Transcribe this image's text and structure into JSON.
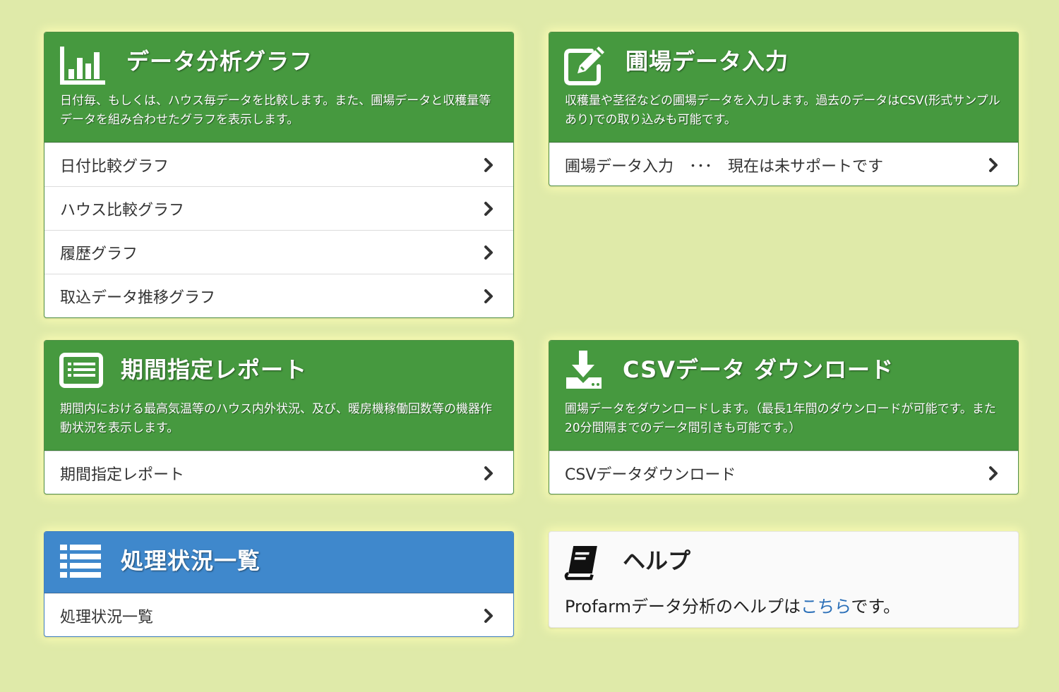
{
  "panels": {
    "graph": {
      "title": "データ分析グラフ",
      "description": "日付毎、もしくは、ハウス毎データを比較します。また、圃場データと収穫量等データを組み合わせたグラフを表示します。",
      "items": [
        "日付比較グラフ",
        "ハウス比較グラフ",
        "履歴グラフ",
        "取込データ推移グラフ"
      ]
    },
    "field_input": {
      "title": "圃場データ入力",
      "description": "収穫量や茎径などの圃場データを入力します。過去のデータはCSV(形式サンプルあり)での取り込みも可能です。",
      "items": [
        "圃場データ入力　･･･　現在は未サポートです"
      ]
    },
    "report": {
      "title": "期間指定レポート",
      "description": "期間内における最高気温等のハウス内外状況、及び、暖房機稼働回数等の機器作動状況を表示します。",
      "items": [
        "期間指定レポート"
      ]
    },
    "csv": {
      "title": "CSVデータ ダウンロード",
      "description": "圃場データをダウンロードします。（最長1年間のダウンロードが可能です。また20分間隔までのデータ間引きも可能です。）",
      "items": [
        "CSVデータダウンロード"
      ]
    },
    "status": {
      "title": "処理状況一覧",
      "items": [
        "処理状況一覧"
      ]
    },
    "help": {
      "title": "ヘルプ",
      "text_before": "Profarmデータ分析のヘルプは",
      "link": "こちら",
      "text_after": "です。"
    }
  },
  "colors": {
    "background": "#dfeaa9",
    "green_header": "#46993f",
    "blue_header": "#3f88cc",
    "link": "#2a6fb8"
  },
  "icons": [
    "bar-chart-icon",
    "edit-icon",
    "report-list-icon",
    "download-icon",
    "list-icon",
    "book-icon",
    "chevron-right-icon"
  ]
}
